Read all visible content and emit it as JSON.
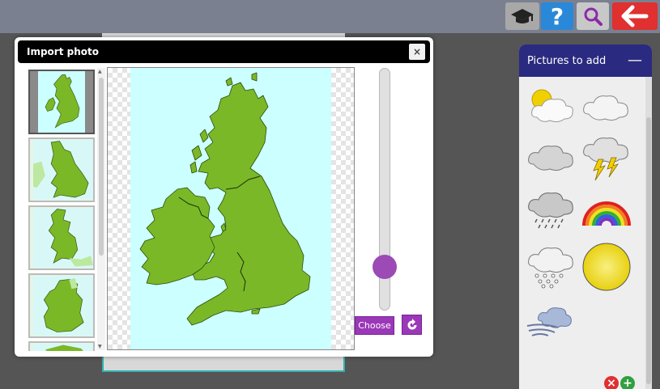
{
  "toolbar": {
    "icons": [
      "graduation-cap-icon",
      "help-icon",
      "search-icon",
      "back-arrow-icon"
    ],
    "help_glyph": "?",
    "colors": {
      "cap": "#a8a8a8",
      "help": "#2a88d8",
      "search": "#c8c8c8",
      "back": "#e03030"
    }
  },
  "modal": {
    "title": "Import photo",
    "close_glyph": "×",
    "choose_label": "Choose",
    "zoom_level": 0.18,
    "thumbnail_count": 5,
    "selected_thumbnail": 1
  },
  "right_panel": {
    "title": "Pictures to add",
    "minimize_glyph": "—",
    "pictures": [
      "sun-behind-cloud-icon",
      "cloud-icon",
      "grey-cloud-icon",
      "thunderstorm-icon",
      "rain-cloud-icon",
      "rainbow-icon",
      "snow-cloud-icon",
      "sun-icon",
      "windy-cloud-icon"
    ],
    "delete_glyph": "×",
    "add_glyph": "+"
  },
  "colors": {
    "accent_purple": "#9a38b8",
    "panel_header": "#2a2a80",
    "map_green": "#7ab828",
    "map_sea": "#ccffff"
  }
}
